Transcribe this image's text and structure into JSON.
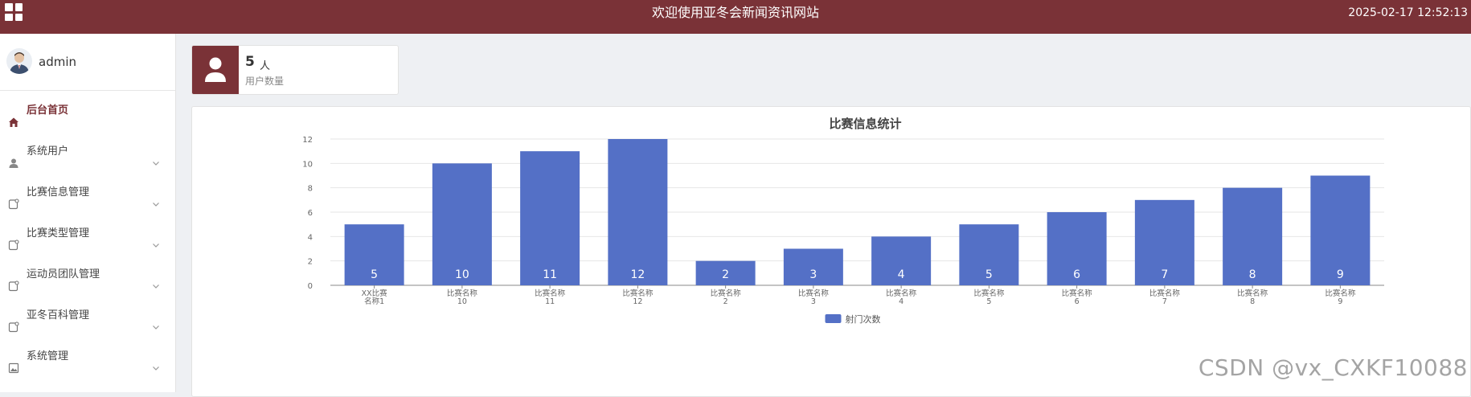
{
  "topbar": {
    "title": "欢迎使用亚冬会新闻资讯网站",
    "datetime": "2025-02-17 12:52:13"
  },
  "sidebar": {
    "username": "admin",
    "items": [
      {
        "label": "后台首页",
        "icon": "home-icon",
        "active": true,
        "has_children": false
      },
      {
        "label": "系统用户",
        "icon": "user-icon",
        "active": false,
        "has_children": true
      },
      {
        "label": "比赛信息管理",
        "icon": "doc-icon",
        "active": false,
        "has_children": true
      },
      {
        "label": "比赛类型管理",
        "icon": "doc-icon",
        "active": false,
        "has_children": true
      },
      {
        "label": "运动员团队管理",
        "icon": "doc-icon",
        "active": false,
        "has_children": true
      },
      {
        "label": "亚冬百科管理",
        "icon": "doc-icon",
        "active": false,
        "has_children": true
      },
      {
        "label": "系统管理",
        "icon": "image-icon",
        "active": false,
        "has_children": true
      }
    ]
  },
  "stat": {
    "value": "5",
    "unit": "人",
    "label": "用户数量"
  },
  "colors": {
    "brand": "#7a3237",
    "bar": "#5470c6"
  },
  "chart_data": {
    "type": "bar",
    "title": "比赛信息统计",
    "categories": [
      [
        "XX比赛",
        "名称1"
      ],
      [
        "比赛名称",
        "10"
      ],
      [
        "比赛名称",
        "11"
      ],
      [
        "比赛名称",
        "12"
      ],
      [
        "比赛名称",
        "2"
      ],
      [
        "比赛名称",
        "3"
      ],
      [
        "比赛名称",
        "4"
      ],
      [
        "比赛名称",
        "5"
      ],
      [
        "比赛名称",
        "6"
      ],
      [
        "比赛名称",
        "7"
      ],
      [
        "比赛名称",
        "8"
      ],
      [
        "比赛名称",
        "9"
      ]
    ],
    "series": [
      {
        "name": "射门次数",
        "values": [
          5,
          10,
          11,
          12,
          2,
          3,
          4,
          5,
          6,
          7,
          8,
          9
        ]
      }
    ],
    "ylim": [
      0,
      12
    ],
    "yticks": [
      0,
      2,
      4,
      6,
      8,
      10,
      12
    ],
    "grid": true,
    "legend": "bottom-center"
  },
  "watermark": "CSDN @vx_CXKF10088"
}
